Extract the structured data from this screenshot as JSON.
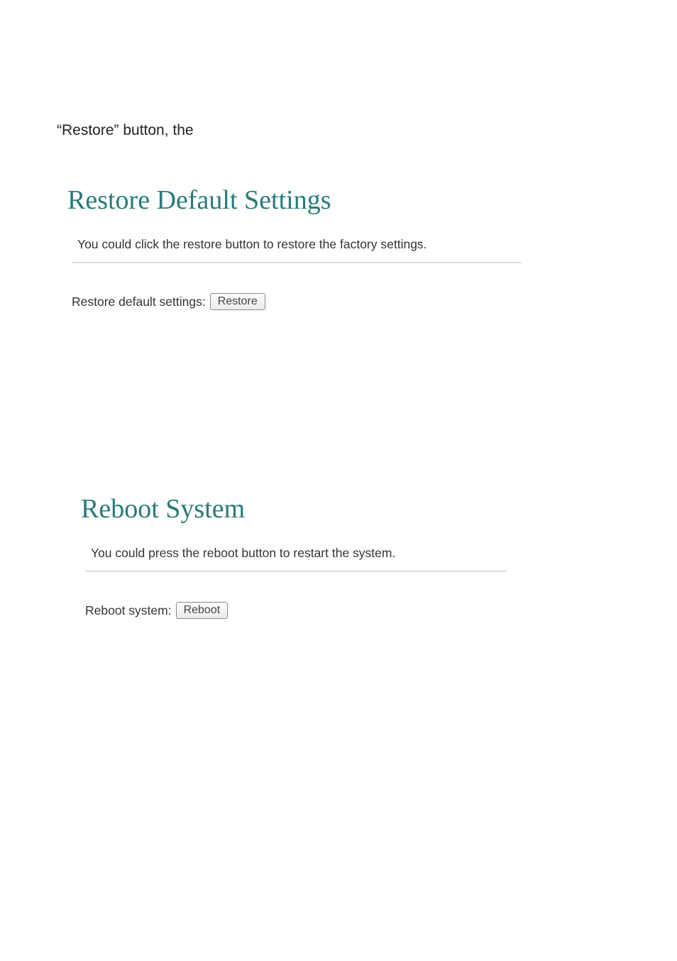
{
  "intro_fragment": "“Restore” button, the",
  "restore": {
    "title": "Restore Default Settings",
    "description": "You could click the restore button to restore the factory settings.",
    "field_label": "Restore default settings:",
    "button_label": "Restore"
  },
  "reboot": {
    "title": "Reboot System",
    "description": "You could press the reboot button to restart the system.",
    "field_label": "Reboot system:",
    "button_label": "Reboot"
  }
}
